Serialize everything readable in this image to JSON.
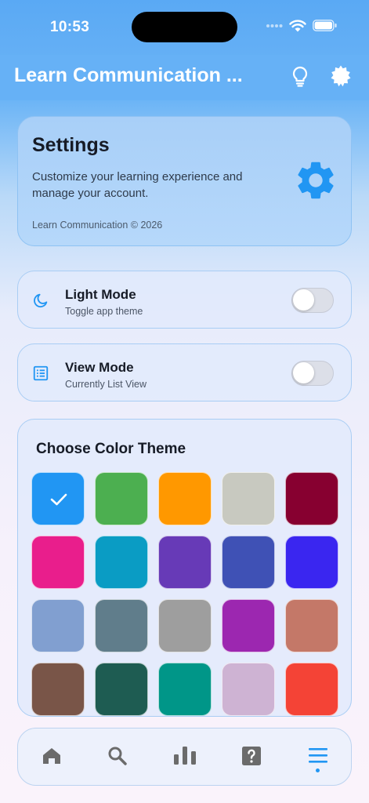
{
  "status_bar": {
    "time": "10:53"
  },
  "app_bar": {
    "title": "Learn Communication ...",
    "icons": [
      "lightbulb-icon",
      "settings-burst-icon"
    ]
  },
  "settings_card": {
    "title": "Settings",
    "description": "Customize your learning experience and manage your account.",
    "copyright": "Learn Communication © 2026",
    "icon": "gear-icon",
    "icon_color": "#2196f3"
  },
  "light_mode": {
    "title": "Light Mode",
    "subtitle": "Toggle app theme",
    "icon": "moon-icon",
    "enabled": false
  },
  "view_mode": {
    "title": "View Mode",
    "subtitle": "Currently List View",
    "icon": "list-view-icon",
    "enabled": false
  },
  "color_theme": {
    "title": "Choose Color Theme",
    "selected_index": 0,
    "swatches": [
      "#2196f3",
      "#4caf50",
      "#ff9800",
      "#c8c9c0",
      "#870030",
      "#e91e8c",
      "#0a9cc4",
      "#673ab7",
      "#3f51b5",
      "#3a26f0",
      "#819fd0",
      "#607d8b",
      "#9e9e9e",
      "#9c27b0",
      "#c47868",
      "#795548",
      "#1e5c52",
      "#009688",
      "#ceb3d3",
      "#f44336"
    ]
  },
  "bottom_nav": {
    "items": [
      "home-icon",
      "search-icon",
      "bar-chart-icon",
      "help-icon",
      "menu-icon"
    ],
    "active_index": 4,
    "active_color": "#2196f3",
    "inactive_color": "#6b6b6b"
  }
}
